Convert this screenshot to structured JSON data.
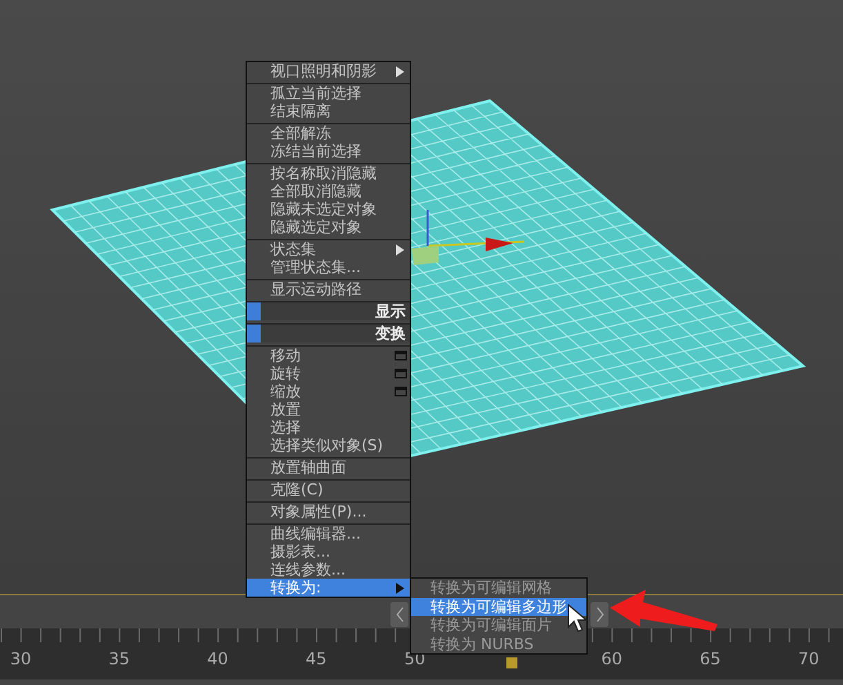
{
  "context_menu": {
    "sections": [
      {
        "items": [
          {
            "kind": "item",
            "label": "视口照明和阴影",
            "submenu": true,
            "selected": false
          }
        ]
      },
      {
        "items": [
          {
            "kind": "item",
            "label": "孤立当前选择",
            "selected": false
          },
          {
            "kind": "item",
            "label": "结束隔离",
            "selected": false
          }
        ]
      },
      {
        "items": [
          {
            "kind": "item",
            "label": "全部解冻",
            "selected": false
          },
          {
            "kind": "item",
            "label": "冻结当前选择",
            "selected": false
          }
        ]
      },
      {
        "items": [
          {
            "kind": "item",
            "label": "按名称取消隐藏",
            "selected": false
          },
          {
            "kind": "item",
            "label": "全部取消隐藏",
            "selected": false
          },
          {
            "kind": "item",
            "label": "隐藏未选定对象",
            "selected": false
          },
          {
            "kind": "item",
            "label": "隐藏选定对象",
            "selected": false
          }
        ]
      },
      {
        "items": [
          {
            "kind": "item",
            "label": "状态集",
            "submenu": true,
            "selected": false
          },
          {
            "kind": "item",
            "label": "管理状态集...",
            "selected": false
          }
        ]
      },
      {
        "items": [
          {
            "kind": "item",
            "label": "显示运动路径",
            "selected": false
          }
        ]
      },
      {
        "items": [
          {
            "kind": "header",
            "label": "显示"
          }
        ]
      },
      {
        "items": [
          {
            "kind": "header",
            "label": "变换"
          }
        ]
      },
      {
        "items": [
          {
            "kind": "item",
            "label": "移动",
            "options": true,
            "selected": false
          },
          {
            "kind": "item",
            "label": "旋转",
            "options": true,
            "selected": false
          },
          {
            "kind": "item",
            "label": "缩放",
            "options": true,
            "selected": false
          },
          {
            "kind": "item",
            "label": "放置",
            "selected": false
          },
          {
            "kind": "item",
            "label": "选择",
            "selected": false
          },
          {
            "kind": "item",
            "label": "选择类似对象(S)",
            "selected": false
          }
        ]
      },
      {
        "items": [
          {
            "kind": "item",
            "label": "放置轴曲面",
            "selected": false
          }
        ]
      },
      {
        "items": [
          {
            "kind": "item",
            "label": "克隆(C)",
            "selected": false
          }
        ]
      },
      {
        "items": [
          {
            "kind": "item",
            "label": "对象属性(P)...",
            "selected": false
          }
        ]
      },
      {
        "items": [
          {
            "kind": "item",
            "label": "曲线编辑器...",
            "selected": false
          },
          {
            "kind": "item",
            "label": "摄影表...",
            "selected": false
          },
          {
            "kind": "item",
            "label": "连线参数...",
            "selected": false
          },
          {
            "kind": "item",
            "label": "转换为:",
            "submenu": true,
            "selected": true
          }
        ]
      }
    ]
  },
  "submenu": {
    "items": [
      {
        "label": "转换为可编辑网格",
        "selected": false
      },
      {
        "label": "转换为可编辑多边形",
        "selected": true
      },
      {
        "label": "转换为可编辑面片",
        "selected": false
      },
      {
        "label": "转换为 NURBS",
        "selected": false
      }
    ]
  },
  "timeline": {
    "ruler_labels": [
      "30",
      "35",
      "40",
      "45",
      "50",
      "60",
      "65",
      "70"
    ]
  }
}
